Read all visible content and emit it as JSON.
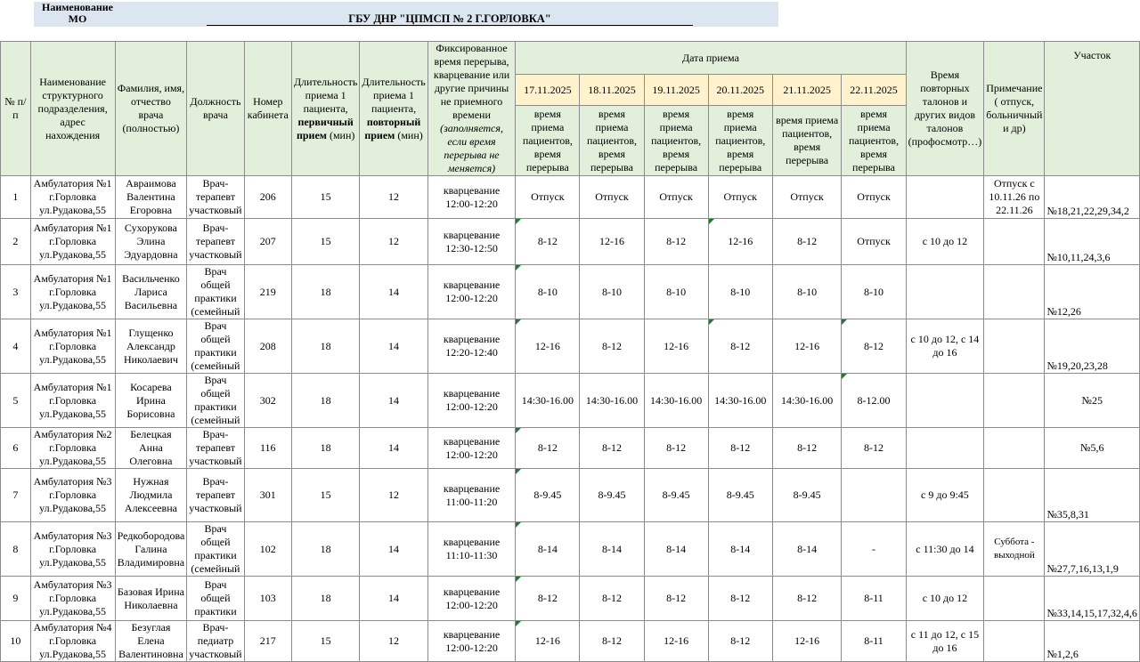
{
  "header": {
    "mo_label": "Наименование МО",
    "org_name": "ГБУ ДНР \"ЦПМСП № 2 Г.ГОРЛОВКА\""
  },
  "columns": {
    "num": "№ п/п",
    "unit": "Наименование структурного подразделения, адрес нахождения",
    "name": "Фамилия, имя, отчество врача (полностью)",
    "position": "Должность врача",
    "room": "Номер кабинета",
    "dur1_a": "Длительность приема 1 пациента,",
    "dur1_b": "первичный прием",
    "dur1_c": "(мин)",
    "dur2_a": "Длительность приема 1 пациента,",
    "dur2_b": "повторный прием",
    "dur2_c": "(мин)",
    "break_a": "Фиксированное время перерыва, кварцевание или другие причины не приемного времени",
    "break_b": "(заполняется, если время перерыва не меняется)",
    "date_group": "Дата приема",
    "dates": [
      "17.11.2025",
      "18.11.2025",
      "19.11.2025",
      "20.11.2025",
      "21.11.2025",
      "22.11.2025"
    ],
    "date_sub": "время приема пациентов, время перерыва",
    "repeat_a": "Время повторных талонов и других видов талонов",
    "repeat_b": "(профосмотр…)",
    "note": "Примечание ( отпуск, больничный и др)",
    "district": "Участок"
  },
  "rows": [
    {
      "n": "1",
      "unit": "Амбулатория №1 г.Горловка ул.Рудакова,55",
      "name": "Авраимова Валентина Егоровна",
      "pos": "Врач-терапевт участковый",
      "room": "206",
      "d1": "15",
      "d2": "12",
      "brk": "кварцевание 12:00-12:20",
      "days": [
        "Отпуск",
        "Отпуск",
        "Отпуск",
        "Отпуск",
        "Отпуск",
        "Отпуск"
      ],
      "rep": "",
      "note": "Отпуск с 10.11.26 по 22.11.26",
      "dist": "№18,21,22,29,34,2"
    },
    {
      "n": "2",
      "unit": "Амбулатория №1 г.Горловка ул.Рудакова,55",
      "name": "Сухорукова Элина Эдуардовна",
      "pos": "Врач-терапевт участковый",
      "room": "207",
      "d1": "15",
      "d2": "12",
      "brk": "кварцевание 12:30-12:50",
      "days": [
        "8-12",
        "12-16",
        "8-12",
        "12-16",
        "8-12",
        "Отпуск"
      ],
      "rep": "с 10 до 12",
      "note": "",
      "dist": "№10,11,24,3,6"
    },
    {
      "n": "3",
      "unit": "Амбулатория №1 г.Горловка ул.Рудакова,55",
      "name": "Васильченко Лариса Васильевна",
      "pos": "Врач общей практики (семейный",
      "room": "219",
      "d1": "18",
      "d2": "14",
      "brk": "кварцевание 12:00-12:20",
      "days": [
        "8-10",
        "8-10",
        "8-10",
        "8-10",
        "8-10",
        "8-10"
      ],
      "rep": "",
      "note": "",
      "dist": "№12,26"
    },
    {
      "n": "4",
      "unit": "Амбулатория №1 г.Горловка ул.Рудакова,55",
      "name": "Глущенко Александр Николаевич",
      "pos": "Врач общей практики (семейный",
      "room": "208",
      "d1": "18",
      "d2": "14",
      "brk": "кварцевание 12:20-12:40",
      "days": [
        "12-16",
        "8-12",
        "12-16",
        "8-12",
        "12-16",
        "8-12"
      ],
      "rep": "с 10 до 12, с 14 до 16",
      "note": "",
      "dist": "№19,20,23,28"
    },
    {
      "n": "5",
      "unit": "Амбулатория №1 г.Горловка ул.Рудакова,55",
      "name": "Косарева Ирина Борисовна",
      "pos": "Врач общей практики (семейный",
      "room": "302",
      "d1": "18",
      "d2": "14",
      "brk": "кварцевание 12:00-12:20",
      "days": [
        "14:30-16.00",
        "14:30-16.00",
        "14:30-16.00",
        "14:30-16.00",
        "14:30-16.00",
        "8-12.00"
      ],
      "rep": "",
      "note": "",
      "dist": "№25"
    },
    {
      "n": "6",
      "unit": "Амбулатория №2 г.Горловка ул.Рудакова,55",
      "name": "Белецкая Анна Олеговна",
      "pos": "Врач-терапевт участковый",
      "room": "116",
      "d1": "18",
      "d2": "14",
      "brk": "кварцевание 12:00-12:20",
      "days": [
        "8-12",
        "8-12",
        "8-12",
        "8-12",
        "8-12",
        "8-12"
      ],
      "rep": "",
      "note": "",
      "dist": "№5,6"
    },
    {
      "n": "7",
      "unit": "Амбулатория №3 г.Горловка ул.Рудакова,55",
      "name": "Нужная Людмила Алексеевна",
      "pos": "Врач-терапевт участковый",
      "room": "301",
      "d1": "15",
      "d2": "12",
      "brk": "кварцевание 11:00-11:20",
      "days": [
        "8-9.45",
        "8-9.45",
        "8-9.45",
        "8-9.45",
        "8-9.45",
        ""
      ],
      "rep": "с 9 до 9:45",
      "note": "",
      "dist": "№35,8,31"
    },
    {
      "n": "8",
      "unit": "Амбулатория №3 г.Горловка ул.Рудакова,55",
      "name": "Редкобородова Галина Владимировна",
      "pos": "Врач общей практики (семейный",
      "room": "102",
      "d1": "18",
      "d2": "14",
      "brk": "кварцевание 11:10-11:30",
      "days": [
        "8-14",
        "8-14",
        "8-14",
        "8-14",
        "8-14",
        "-"
      ],
      "rep": "с 11:30 до 14",
      "note": "Суббота - выходной",
      "dist": "№27,7,16,13,1,9"
    },
    {
      "n": "9",
      "unit": "Амбулатория №3 г.Горловка ул.Рудакова,55",
      "name": "Базовая Ирина Николаевна",
      "pos": "Врач общей практики",
      "room": "103",
      "d1": "18",
      "d2": "14",
      "brk": "кварцевание 12:00-12:20",
      "days": [
        "8-12",
        "8-12",
        "8-12",
        "8-12",
        "8-12",
        "8-11"
      ],
      "rep": "с 10 до 12",
      "note": "",
      "dist": "№33,14,15,17,32,4,6"
    },
    {
      "n": "10",
      "unit": "Амбулатория №4 г.Горловка ул.Рудакова,55",
      "name": "Безуглая Елена Валентиновна",
      "pos": "Врач-педиатр участковый",
      "room": "217",
      "d1": "15",
      "d2": "12",
      "brk": "кварцевание 12:00-12:20",
      "days": [
        "12-16",
        "8-12",
        "12-16",
        "8-12",
        "12-16",
        "8-11"
      ],
      "rep": "с 11 до 12, с 15 до 16",
      "note": "",
      "dist": "№1,2,6"
    }
  ]
}
